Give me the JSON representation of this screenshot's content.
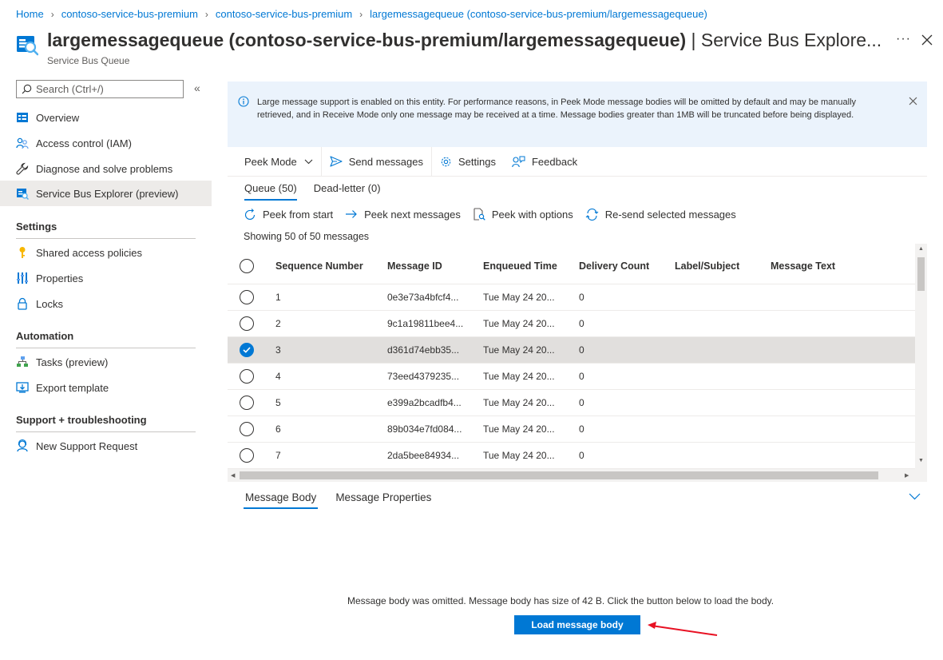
{
  "breadcrumb": [
    "Home",
    "contoso-service-bus-premium",
    "contoso-service-bus-premium",
    "largemessagequeue (contoso-service-bus-premium/largemessagequeue)"
  ],
  "header": {
    "title_main": "largemessagequeue (contoso-service-bus-premium/largemessagequeue)",
    "title_suffix": " | Service Bus Explore...",
    "subtitle": "Service Bus Queue",
    "more": "···"
  },
  "sidebar": {
    "search_placeholder": "Search (Ctrl+/)",
    "collapse": "«",
    "items": [
      {
        "label": "Overview",
        "icon": "overview-icon"
      },
      {
        "label": "Access control (IAM)",
        "icon": "people-icon"
      },
      {
        "label": "Diagnose and solve problems",
        "icon": "wrench-icon"
      },
      {
        "label": "Service Bus Explorer (preview)",
        "icon": "service-bus-explorer-icon",
        "active": true
      }
    ],
    "sections": [
      {
        "title": "Settings",
        "items": [
          {
            "label": "Shared access policies",
            "icon": "key-icon"
          },
          {
            "label": "Properties",
            "icon": "properties-icon"
          },
          {
            "label": "Locks",
            "icon": "lock-icon"
          }
        ]
      },
      {
        "title": "Automation",
        "items": [
          {
            "label": "Tasks (preview)",
            "icon": "tasks-icon"
          },
          {
            "label": "Export template",
            "icon": "export-icon"
          }
        ]
      },
      {
        "title": "Support + troubleshooting",
        "items": [
          {
            "label": "New Support Request",
            "icon": "support-icon"
          }
        ]
      }
    ]
  },
  "banner": {
    "text": "Large message support is enabled on this entity. For performance reasons, in Peek Mode message bodies will be omitted by default and may be manually retrieved, and in Receive Mode only one message may be received at a time. Message bodies greater than 1MB will be truncated before being displayed."
  },
  "toolbar": {
    "mode": "Peek Mode",
    "send": "Send messages",
    "settings": "Settings",
    "feedback": "Feedback"
  },
  "queue_tabs": {
    "queue": "Queue (50)",
    "deadletter": "Dead-letter (0)"
  },
  "actions": {
    "peek_start": "Peek from start",
    "peek_next": "Peek next messages",
    "peek_options": "Peek with options",
    "resend": "Re-send selected messages"
  },
  "showing": "Showing 50 of 50 messages",
  "table": {
    "columns": [
      "Sequence Number",
      "Message ID",
      "Enqueued Time",
      "Delivery Count",
      "Label/Subject",
      "Message Text"
    ],
    "rows": [
      {
        "seq": "1",
        "id": "0e3e73a4bfcf4...",
        "time": "Tue May 24 20...",
        "count": "0",
        "label": "",
        "text": "",
        "selected": false
      },
      {
        "seq": "2",
        "id": "9c1a19811bee4...",
        "time": "Tue May 24 20...",
        "count": "0",
        "label": "",
        "text": "",
        "selected": false
      },
      {
        "seq": "3",
        "id": "d361d74ebb35...",
        "time": "Tue May 24 20...",
        "count": "0",
        "label": "",
        "text": "",
        "selected": true
      },
      {
        "seq": "4",
        "id": "73eed4379235...",
        "time": "Tue May 24 20...",
        "count": "0",
        "label": "",
        "text": "",
        "selected": false
      },
      {
        "seq": "5",
        "id": "e399a2bcadfb4...",
        "time": "Tue May 24 20...",
        "count": "0",
        "label": "",
        "text": "",
        "selected": false
      },
      {
        "seq": "6",
        "id": "89b034e7fd084...",
        "time": "Tue May 24 20...",
        "count": "0",
        "label": "",
        "text": "",
        "selected": false
      },
      {
        "seq": "7",
        "id": "2da5bee84934...",
        "time": "Tue May 24 20...",
        "count": "0",
        "label": "",
        "text": "",
        "selected": false
      }
    ]
  },
  "body_tabs": {
    "body": "Message Body",
    "props": "Message Properties"
  },
  "message_body": {
    "omitted_text": "Message body was omitted. Message body has size of 42 B. Click the button below to load the body.",
    "load_button": "Load message body"
  },
  "colors": {
    "accent": "#0078d4",
    "annotation_arrow": "#e81123"
  }
}
